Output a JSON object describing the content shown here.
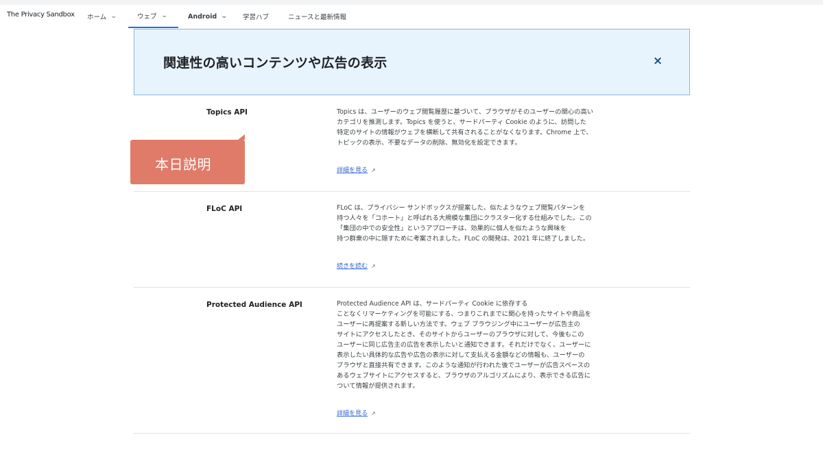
{
  "nav": {
    "brand": "The Privacy Sandbox",
    "items": [
      {
        "label": "ホーム",
        "chevron": true
      },
      {
        "label": "ウェブ",
        "chevron": true
      },
      {
        "label": "Android",
        "chevron": true
      },
      {
        "label": "学習ハブ",
        "chevron": false
      },
      {
        "label": "ニュースと最新情報",
        "chevron": false
      }
    ]
  },
  "banner": {
    "title": "関連性の高いコンテンツや広告の表示",
    "close_icon": "×"
  },
  "callout": {
    "label": "本日説明"
  },
  "apis": [
    {
      "title": "Topics API",
      "lines": [
        "Topics は、ユーザーのウェブ閲覧履歴に基づいて、ブラウザがそのユーザーの関心の高い",
        "カテゴリを推測します。Topics を使うと、サードパーティ Cookie のように、訪問した",
        "特定のサイトの情報がウェブを横断して共有されることがなくなります。Chrome 上で、",
        "トピックの表示、不要なデータの削除、無効化を設定できます。"
      ],
      "link": "詳細を見る"
    },
    {
      "title": "FLoC API",
      "lines": [
        "FLoC は、プライバシー サンドボックスが提案した、似たようなウェブ閲覧パターンを",
        "持つ人々を「コホート」と呼ばれる大規模な集団にクラスター化する仕組みでした。この",
        "「集団の中での安全性」というアプローチは、効果的に個人を似たような興味を",
        "持つ群衆の中に隠すために考案されました。FLoC の開発は、2021 年に終了しました。"
      ],
      "link": "続きを読む"
    },
    {
      "title": "Protected Audience API",
      "lines": [
        "Protected Audience API は、サードパーティ Cookie に依存する",
        "ことなくリマーケティングを可能にする、つまりこれまでに関心を持ったサイトや商品を",
        "ユーザーに再提案する新しい方法です。ウェブ ブラウジング中にユーザーが広告主の",
        "サイトにアクセスしたとき、そのサイトからユーザーのブラウザに対して、今後もこの",
        "ユーザーに同じ広告主の広告を表示したいと通知できます。それだけでなく、ユーザーに",
        "表示したい具体的な広告や広告の表示に対して支払える金額などの情報も、ユーザーの",
        "ブラウザと直接共有できます。このような通知が行われた後でユーザーが広告スペースの",
        "あるウェブサイトにアクセスすると、ブラウザのアルゴリズムにより、表示できる広告に",
        "ついて情報が提供されます。"
      ],
      "link": "詳細を見る"
    }
  ],
  "colors": {
    "accent": "#1a73e8",
    "banner_bg": "#e8f4fd",
    "callout_bg": "#e07b69",
    "link": "#3367d6"
  }
}
